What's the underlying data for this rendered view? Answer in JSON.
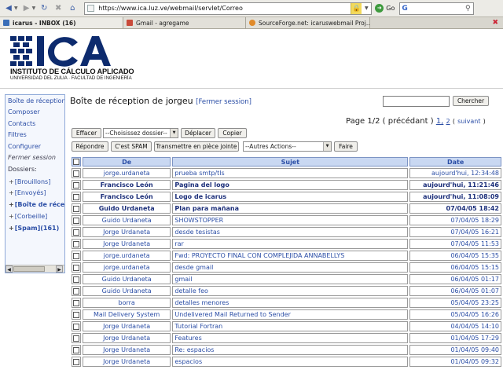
{
  "browser": {
    "url": "https://www.ica.luz.ve/webmail/servlet/Correo",
    "search_label": "G",
    "go_label": "Go",
    "tabs": [
      {
        "label": "icarus - INBOX (16)",
        "icon_color": "#3b6fb8"
      },
      {
        "label": "Gmail - agregame",
        "icon_color": "#c94a3a"
      },
      {
        "label": "SourceForge.net: icaruswebmail Proj...",
        "icon_color": "#e08a2a"
      }
    ]
  },
  "logo": {
    "text": "ICA",
    "line1": "INSTITUTO DE CÁLCULO APLICADO",
    "line2": "UNIVERSIDAD DEL ZULIA · FACULTAD DE INGENIERÍA",
    "color": "#0d2b6e"
  },
  "sidebar": {
    "items": [
      "Boîte de réception",
      "Composer",
      "Contacts",
      "Filtres",
      "Configurer"
    ],
    "logout": "Fermer session",
    "folders_label": "Dossiers:",
    "folders": [
      {
        "label": "[Brouillons]",
        "bold": false
      },
      {
        "label": "[Envoyés]",
        "bold": false
      },
      {
        "label": "[Boîte de réception]",
        "bold": true
      },
      {
        "label": "[Corbeille]",
        "bold": false
      },
      {
        "label": "[Spam](161)",
        "bold": true
      }
    ]
  },
  "main": {
    "title": "Boîte de réception de jorgeu",
    "logout_link": "[Fermer session]",
    "search_button": "Chercher",
    "pager": {
      "prefix": "Page 1/2 (",
      "prev": "précédant",
      "sep": ")",
      "p1": "1,",
      "p2": "2",
      "next_open": "(",
      "next": "suivant",
      "next_close": ")"
    },
    "actions_row1": {
      "delete": "Effacer",
      "folder_select": "--Choisissez dossier--",
      "move": "Déplacer",
      "copy": "Copier"
    },
    "actions_row2": {
      "reply": "Répondre",
      "spam": "C'est SPAM",
      "forward": "Transmettre en pièce jointe",
      "other_select": "--Autres Actions--",
      "do": "Faire"
    }
  },
  "table": {
    "headers": {
      "from": "De",
      "subject": "Sujet",
      "date": "Date"
    },
    "rows": [
      {
        "from": "jorge.urdaneta",
        "subject": "prueba smtp/tls",
        "date": "aujourd'hui, 12:34:48",
        "unread": false
      },
      {
        "from": "Francisco León",
        "subject": "Pagina del logo",
        "date": "aujourd'hui, 11:21:46",
        "unread": true
      },
      {
        "from": "Francisco León",
        "subject": "Logo de icarus",
        "date": "aujourd'hui, 11:08:09",
        "unread": true
      },
      {
        "from": "Guido Urdaneta",
        "subject": "Plan para mañana",
        "date": "07/04/05 18:42",
        "unread": true
      },
      {
        "from": "Guido Urdaneta",
        "subject": "SHOWSTOPPER",
        "date": "07/04/05 18:29",
        "unread": false
      },
      {
        "from": "Jorge Urdaneta",
        "subject": "desde tesistas",
        "date": "07/04/05 16:21",
        "unread": false
      },
      {
        "from": "Jorge Urdaneta",
        "subject": "rar",
        "date": "07/04/05 11:53",
        "unread": false
      },
      {
        "from": "jorge.urdaneta",
        "subject": "Fwd: PROYECTO FINAL CON COMPLEJIDA ANNABELLYS",
        "date": "06/04/05 15:35",
        "unread": false
      },
      {
        "from": "jorge.urdaneta",
        "subject": "desde gmail",
        "date": "06/04/05 15:15",
        "unread": false
      },
      {
        "from": "Guido Urdaneta",
        "subject": "gmail",
        "date": "06/04/05 01:17",
        "unread": false
      },
      {
        "from": "Guido Urdaneta",
        "subject": "detalle feo",
        "date": "06/04/05 01:07",
        "unread": false
      },
      {
        "from": "borra",
        "subject": "detalles menores",
        "date": "05/04/05 23:25",
        "unread": false
      },
      {
        "from": "Mail Delivery System",
        "subject": "Undelivered Mail Returned to Sender",
        "date": "05/04/05 16:26",
        "unread": false
      },
      {
        "from": "Jorge Urdaneta",
        "subject": "Tutorial Fortran",
        "date": "04/04/05 14:10",
        "unread": false
      },
      {
        "from": "Jorge Urdaneta",
        "subject": "Features",
        "date": "01/04/05 17:29",
        "unread": false
      },
      {
        "from": "Jorge Urdaneta",
        "subject": "Re: espacios",
        "date": "01/04/05 09:40",
        "unread": false
      },
      {
        "from": "Jorge Urdaneta",
        "subject": "espacios",
        "date": "01/04/05 09:32",
        "unread": false
      }
    ]
  }
}
